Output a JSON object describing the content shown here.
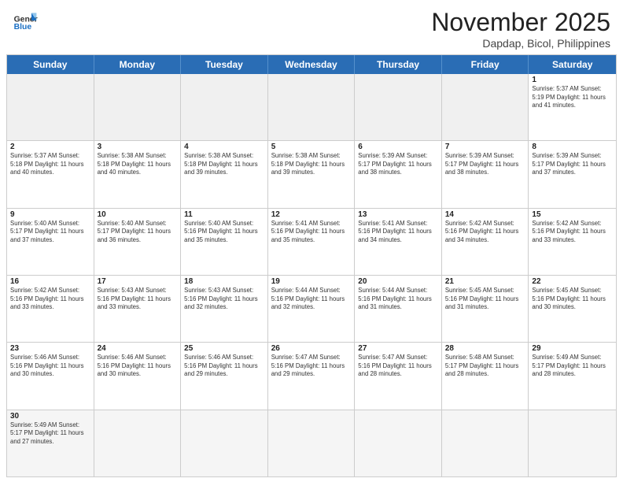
{
  "header": {
    "logo_text_general": "General",
    "logo_text_blue": "Blue",
    "month_title": "November 2025",
    "subtitle": "Dapdap, Bicol, Philippines"
  },
  "day_headers": [
    "Sunday",
    "Monday",
    "Tuesday",
    "Wednesday",
    "Thursday",
    "Friday",
    "Saturday"
  ],
  "weeks": [
    [
      {
        "day": "",
        "empty": true,
        "info": ""
      },
      {
        "day": "",
        "empty": true,
        "info": ""
      },
      {
        "day": "",
        "empty": true,
        "info": ""
      },
      {
        "day": "",
        "empty": true,
        "info": ""
      },
      {
        "day": "",
        "empty": true,
        "info": ""
      },
      {
        "day": "",
        "empty": true,
        "info": ""
      },
      {
        "day": "1",
        "empty": false,
        "info": "Sunrise: 5:37 AM\nSunset: 5:19 PM\nDaylight: 11 hours\nand 41 minutes."
      }
    ],
    [
      {
        "day": "2",
        "empty": false,
        "info": "Sunrise: 5:37 AM\nSunset: 5:18 PM\nDaylight: 11 hours\nand 40 minutes."
      },
      {
        "day": "3",
        "empty": false,
        "info": "Sunrise: 5:38 AM\nSunset: 5:18 PM\nDaylight: 11 hours\nand 40 minutes."
      },
      {
        "day": "4",
        "empty": false,
        "info": "Sunrise: 5:38 AM\nSunset: 5:18 PM\nDaylight: 11 hours\nand 39 minutes."
      },
      {
        "day": "5",
        "empty": false,
        "info": "Sunrise: 5:38 AM\nSunset: 5:18 PM\nDaylight: 11 hours\nand 39 minutes."
      },
      {
        "day": "6",
        "empty": false,
        "info": "Sunrise: 5:39 AM\nSunset: 5:17 PM\nDaylight: 11 hours\nand 38 minutes."
      },
      {
        "day": "7",
        "empty": false,
        "info": "Sunrise: 5:39 AM\nSunset: 5:17 PM\nDaylight: 11 hours\nand 38 minutes."
      },
      {
        "day": "8",
        "empty": false,
        "info": "Sunrise: 5:39 AM\nSunset: 5:17 PM\nDaylight: 11 hours\nand 37 minutes."
      }
    ],
    [
      {
        "day": "9",
        "empty": false,
        "info": "Sunrise: 5:40 AM\nSunset: 5:17 PM\nDaylight: 11 hours\nand 37 minutes."
      },
      {
        "day": "10",
        "empty": false,
        "info": "Sunrise: 5:40 AM\nSunset: 5:17 PM\nDaylight: 11 hours\nand 36 minutes."
      },
      {
        "day": "11",
        "empty": false,
        "info": "Sunrise: 5:40 AM\nSunset: 5:16 PM\nDaylight: 11 hours\nand 35 minutes."
      },
      {
        "day": "12",
        "empty": false,
        "info": "Sunrise: 5:41 AM\nSunset: 5:16 PM\nDaylight: 11 hours\nand 35 minutes."
      },
      {
        "day": "13",
        "empty": false,
        "info": "Sunrise: 5:41 AM\nSunset: 5:16 PM\nDaylight: 11 hours\nand 34 minutes."
      },
      {
        "day": "14",
        "empty": false,
        "info": "Sunrise: 5:42 AM\nSunset: 5:16 PM\nDaylight: 11 hours\nand 34 minutes."
      },
      {
        "day": "15",
        "empty": false,
        "info": "Sunrise: 5:42 AM\nSunset: 5:16 PM\nDaylight: 11 hours\nand 33 minutes."
      }
    ],
    [
      {
        "day": "16",
        "empty": false,
        "info": "Sunrise: 5:42 AM\nSunset: 5:16 PM\nDaylight: 11 hours\nand 33 minutes."
      },
      {
        "day": "17",
        "empty": false,
        "info": "Sunrise: 5:43 AM\nSunset: 5:16 PM\nDaylight: 11 hours\nand 33 minutes."
      },
      {
        "day": "18",
        "empty": false,
        "info": "Sunrise: 5:43 AM\nSunset: 5:16 PM\nDaylight: 11 hours\nand 32 minutes."
      },
      {
        "day": "19",
        "empty": false,
        "info": "Sunrise: 5:44 AM\nSunset: 5:16 PM\nDaylight: 11 hours\nand 32 minutes."
      },
      {
        "day": "20",
        "empty": false,
        "info": "Sunrise: 5:44 AM\nSunset: 5:16 PM\nDaylight: 11 hours\nand 31 minutes."
      },
      {
        "day": "21",
        "empty": false,
        "info": "Sunrise: 5:45 AM\nSunset: 5:16 PM\nDaylight: 11 hours\nand 31 minutes."
      },
      {
        "day": "22",
        "empty": false,
        "info": "Sunrise: 5:45 AM\nSunset: 5:16 PM\nDaylight: 11 hours\nand 30 minutes."
      }
    ],
    [
      {
        "day": "23",
        "empty": false,
        "info": "Sunrise: 5:46 AM\nSunset: 5:16 PM\nDaylight: 11 hours\nand 30 minutes."
      },
      {
        "day": "24",
        "empty": false,
        "info": "Sunrise: 5:46 AM\nSunset: 5:16 PM\nDaylight: 11 hours\nand 30 minutes."
      },
      {
        "day": "25",
        "empty": false,
        "info": "Sunrise: 5:46 AM\nSunset: 5:16 PM\nDaylight: 11 hours\nand 29 minutes."
      },
      {
        "day": "26",
        "empty": false,
        "info": "Sunrise: 5:47 AM\nSunset: 5:16 PM\nDaylight: 11 hours\nand 29 minutes."
      },
      {
        "day": "27",
        "empty": false,
        "info": "Sunrise: 5:47 AM\nSunset: 5:16 PM\nDaylight: 11 hours\nand 28 minutes."
      },
      {
        "day": "28",
        "empty": false,
        "info": "Sunrise: 5:48 AM\nSunset: 5:17 PM\nDaylight: 11 hours\nand 28 minutes."
      },
      {
        "day": "29",
        "empty": false,
        "info": "Sunrise: 5:49 AM\nSunset: 5:17 PM\nDaylight: 11 hours\nand 28 minutes."
      }
    ],
    [
      {
        "day": "30",
        "empty": false,
        "last": true,
        "info": "Sunrise: 5:49 AM\nSunset: 5:17 PM\nDaylight: 11 hours\nand 27 minutes."
      },
      {
        "day": "",
        "empty": true,
        "last": true,
        "info": ""
      },
      {
        "day": "",
        "empty": true,
        "last": true,
        "info": ""
      },
      {
        "day": "",
        "empty": true,
        "last": true,
        "info": ""
      },
      {
        "day": "",
        "empty": true,
        "last": true,
        "info": ""
      },
      {
        "day": "",
        "empty": true,
        "last": true,
        "info": ""
      },
      {
        "day": "",
        "empty": true,
        "last": true,
        "info": ""
      }
    ]
  ]
}
